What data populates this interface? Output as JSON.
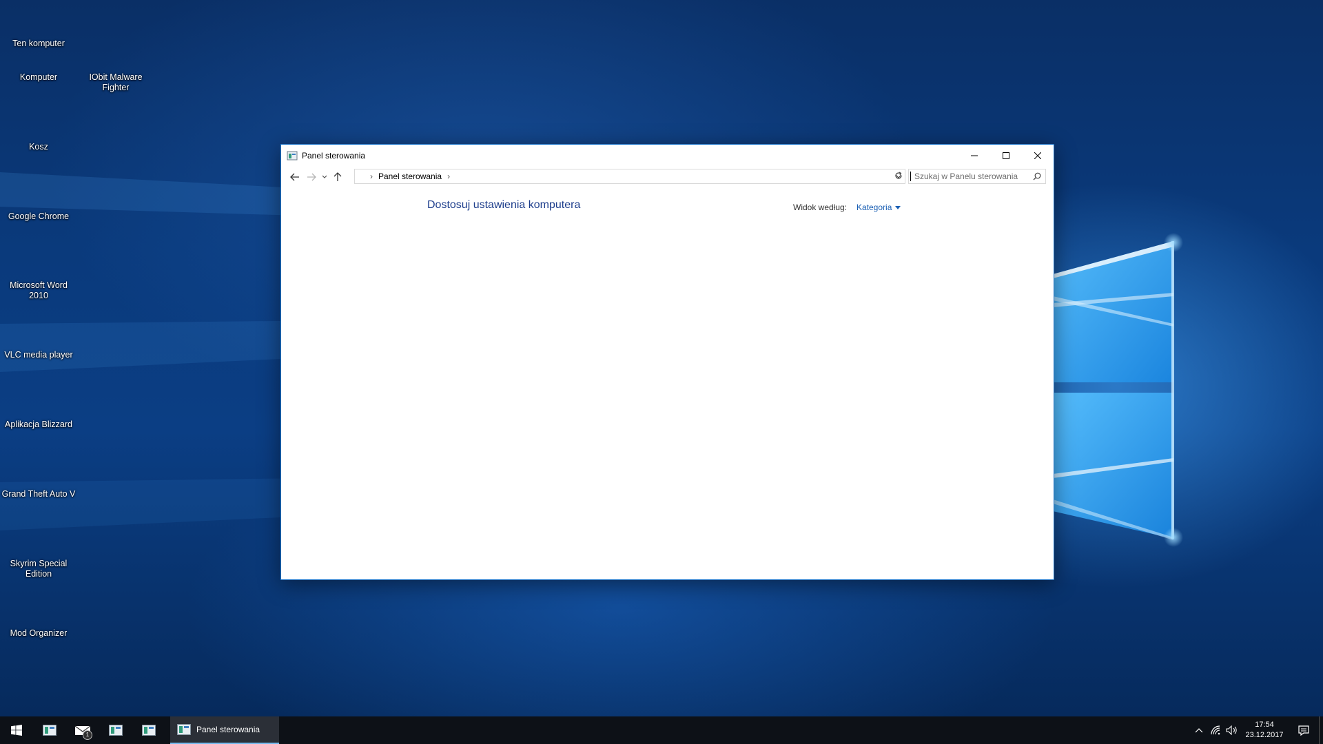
{
  "desktop": {
    "icons_col1": [
      {
        "label": "Ten komputer"
      },
      {
        "label": "Komputer"
      },
      {
        "label": "Kosz"
      },
      {
        "label": "Google Chrome"
      },
      {
        "label": "Microsoft Word 2010"
      },
      {
        "label": "VLC media player"
      },
      {
        "label": "Aplikacja Blizzard"
      },
      {
        "label": "Grand Theft Auto V"
      },
      {
        "label": "Skyrim Special Edition"
      },
      {
        "label": "Mod Organizer"
      }
    ],
    "icons_col2": [
      {
        "label": "IObit Malware Fighter"
      }
    ]
  },
  "window": {
    "title": "Panel sterowania",
    "controls": {
      "minimize": "minimize-icon",
      "maximize": "maximize-icon",
      "close": "close-icon"
    },
    "address": {
      "crumbs": [
        "Panel sterowania"
      ]
    },
    "search": {
      "placeholder": "Szukaj w Panelu sterowania"
    },
    "content": {
      "heading": "Dostosuj ustawienia komputera",
      "view_label": "Widok według:",
      "view_value": "Kategoria"
    }
  },
  "taskbar": {
    "active_app_label": "Panel sterowania",
    "mail_badge": "1",
    "clock_time": "17:54",
    "clock_date": "23.12.2017"
  },
  "colors": {
    "accent": "#1b73c8",
    "link": "#1e3e8c",
    "taskbar": "#0d1117"
  }
}
